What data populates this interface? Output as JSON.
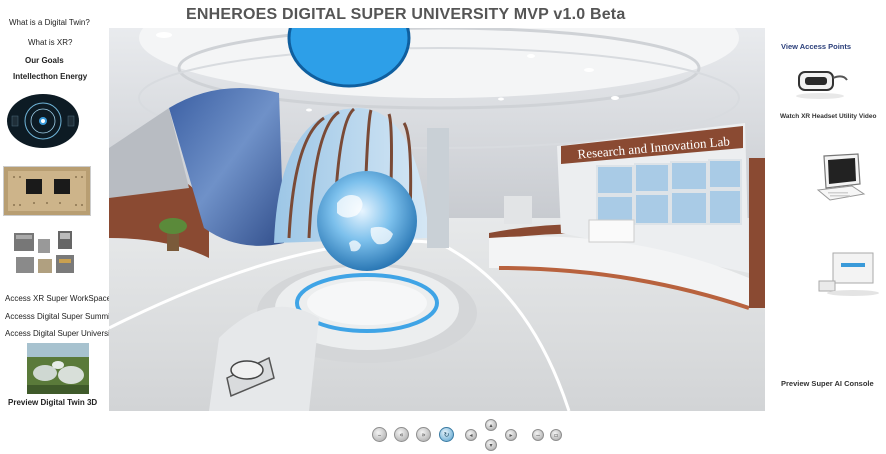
{
  "header": {
    "title": "ENHEROES DIGITAL SUPER UNIVERSITY MVP v1.0 Beta"
  },
  "left_menu": {
    "links": [
      {
        "label": "What is a Digital Twin?",
        "bold": false
      },
      {
        "label": "What is XR?",
        "bold": false
      },
      {
        "label": "Our Goals",
        "bold": true
      },
      {
        "label": "Intellecthon Energy",
        "bold": true
      }
    ],
    "access_links": [
      "Access XR Super WorkSpace",
      "Accesss Digital Super Summit",
      "Access Digital Super University"
    ],
    "preview_label": "Preview Digital Twin 3D"
  },
  "right_menu": {
    "view_access_points": "View Access Points",
    "watch_video": "Watch XR Headset Utility Video",
    "preview_console": "Preview Super AI Console"
  },
  "scene": {
    "lab_sign": "Research and Innovation Lab"
  },
  "controls": [
    {
      "name": "zoom-out",
      "icon": "minus-icon",
      "glyph": "–"
    },
    {
      "name": "rewind",
      "icon": "rewind-icon",
      "glyph": "«"
    },
    {
      "name": "forward",
      "icon": "fast-forward-icon",
      "glyph": "»"
    },
    {
      "name": "autorotate",
      "icon": "rotate-icon",
      "glyph": "↻"
    },
    {
      "name": "pan-left",
      "icon": "arrow-left-icon",
      "glyph": "◂"
    },
    {
      "name": "pan-up",
      "icon": "arrow-up-icon",
      "glyph": "▴"
    },
    {
      "name": "pan-down",
      "icon": "arrow-down-icon",
      "glyph": "▾"
    },
    {
      "name": "pan-right",
      "icon": "arrow-right-icon",
      "glyph": "▸"
    },
    {
      "name": "zoom-in",
      "icon": "zoom-icon",
      "glyph": "−"
    },
    {
      "name": "fullscreen",
      "icon": "fullscreen-icon",
      "glyph": "▫"
    }
  ],
  "colors": {
    "accent_blue": "#3a9ad9",
    "title_gray": "#555555",
    "link_navy": "#2b3f7a"
  }
}
